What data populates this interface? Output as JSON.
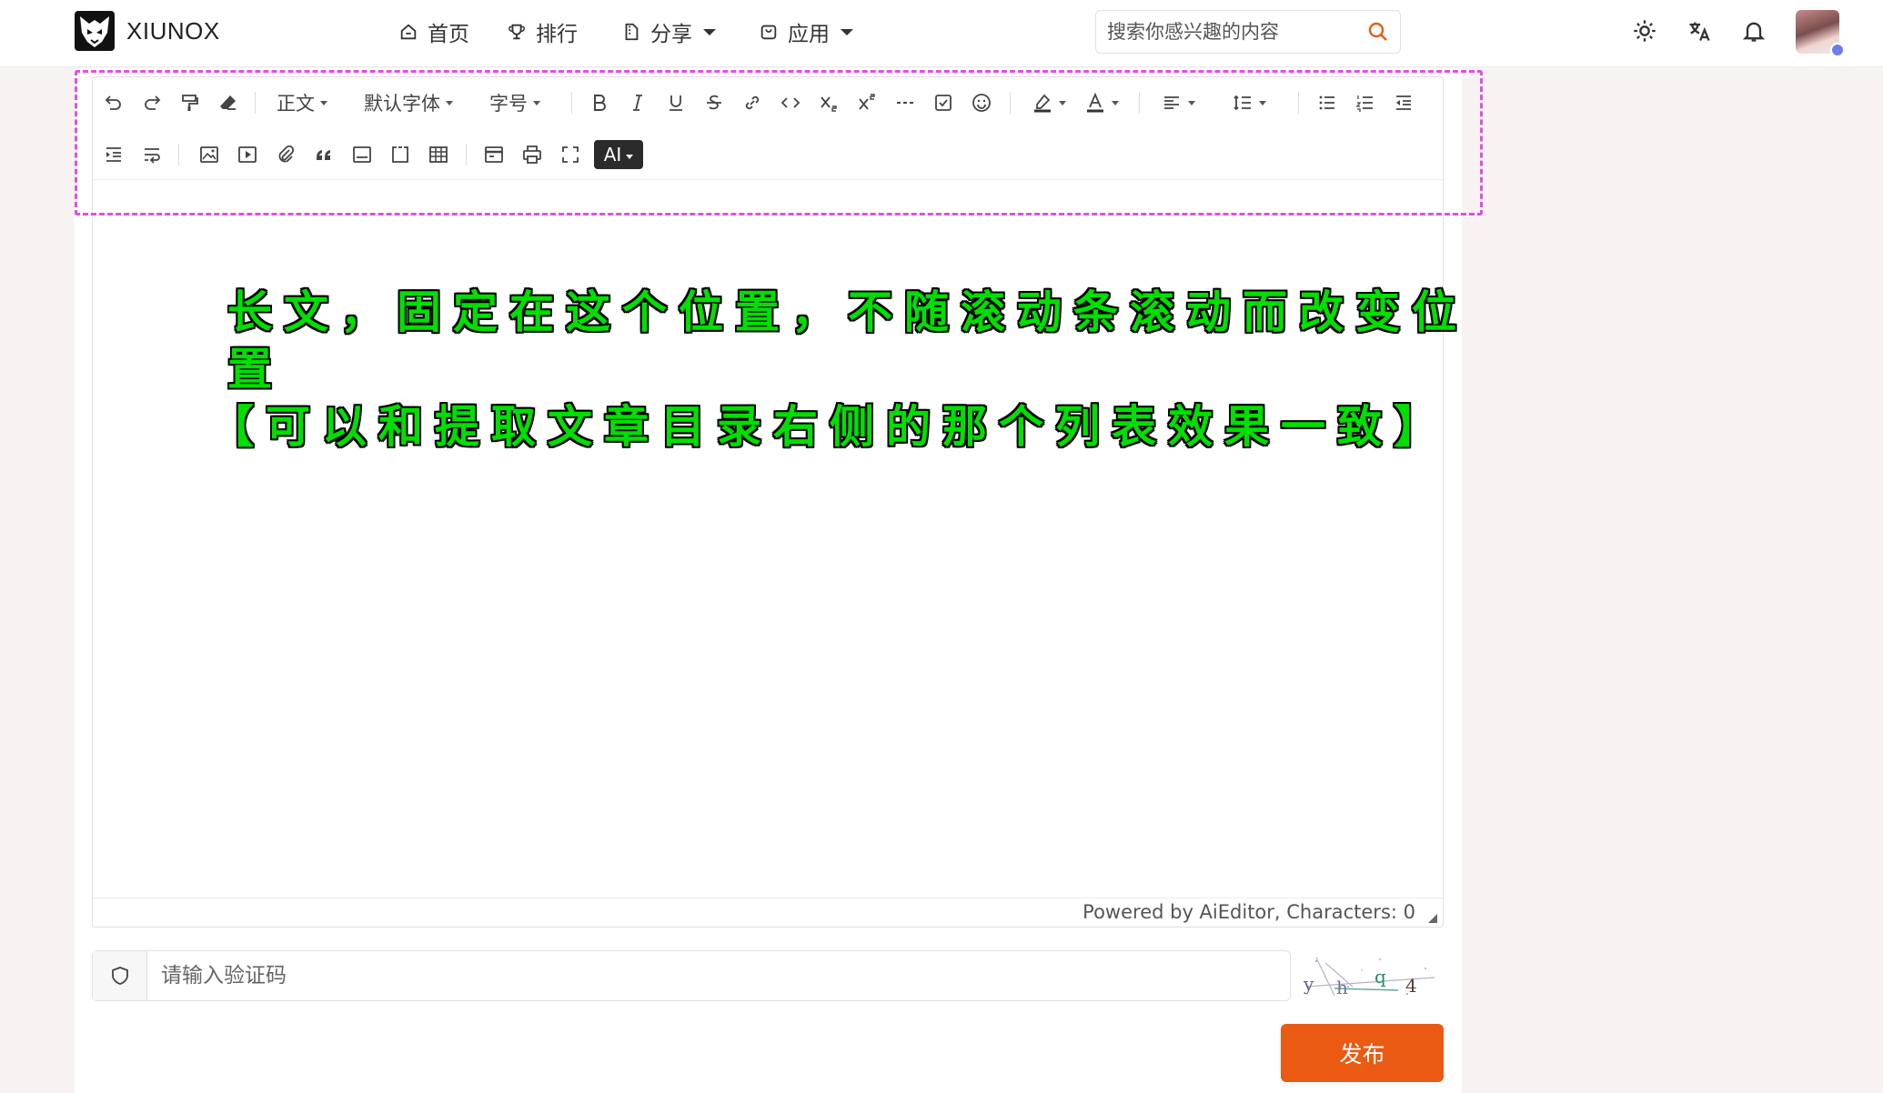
{
  "brand": {
    "name": "XIUNOX"
  },
  "nav": [
    {
      "label": "首页",
      "icon": "home-icon"
    },
    {
      "label": "排行",
      "icon": "trophy-icon"
    },
    {
      "label": "分享",
      "icon": "zip-file-icon"
    },
    {
      "label": "应用",
      "icon": "app-bag-icon"
    }
  ],
  "search": {
    "placeholder": "搜索你感兴趣的内容"
  },
  "header_icons": [
    "sun-icon",
    "translate-icon",
    "bell-icon"
  ],
  "editor": {
    "toolbar": {
      "paragraph_label": "正文",
      "font_family_label": "默认字体",
      "font_size_label": "字号",
      "ai_label": "AI"
    },
    "footer": "Powered by AiEditor, Characters: 0"
  },
  "annotation": {
    "line1": "长文，固定在这个位置，不随滚动条滚动而改变位置",
    "line2": "【可以和提取文章目录右侧的那个列表效果一致】",
    "color": "#00e000"
  },
  "captcha": {
    "placeholder": "请输入验证码",
    "chars": [
      "y",
      "h",
      "q",
      "4"
    ]
  },
  "publish": {
    "label": "发布",
    "color": "#ea5a12"
  }
}
